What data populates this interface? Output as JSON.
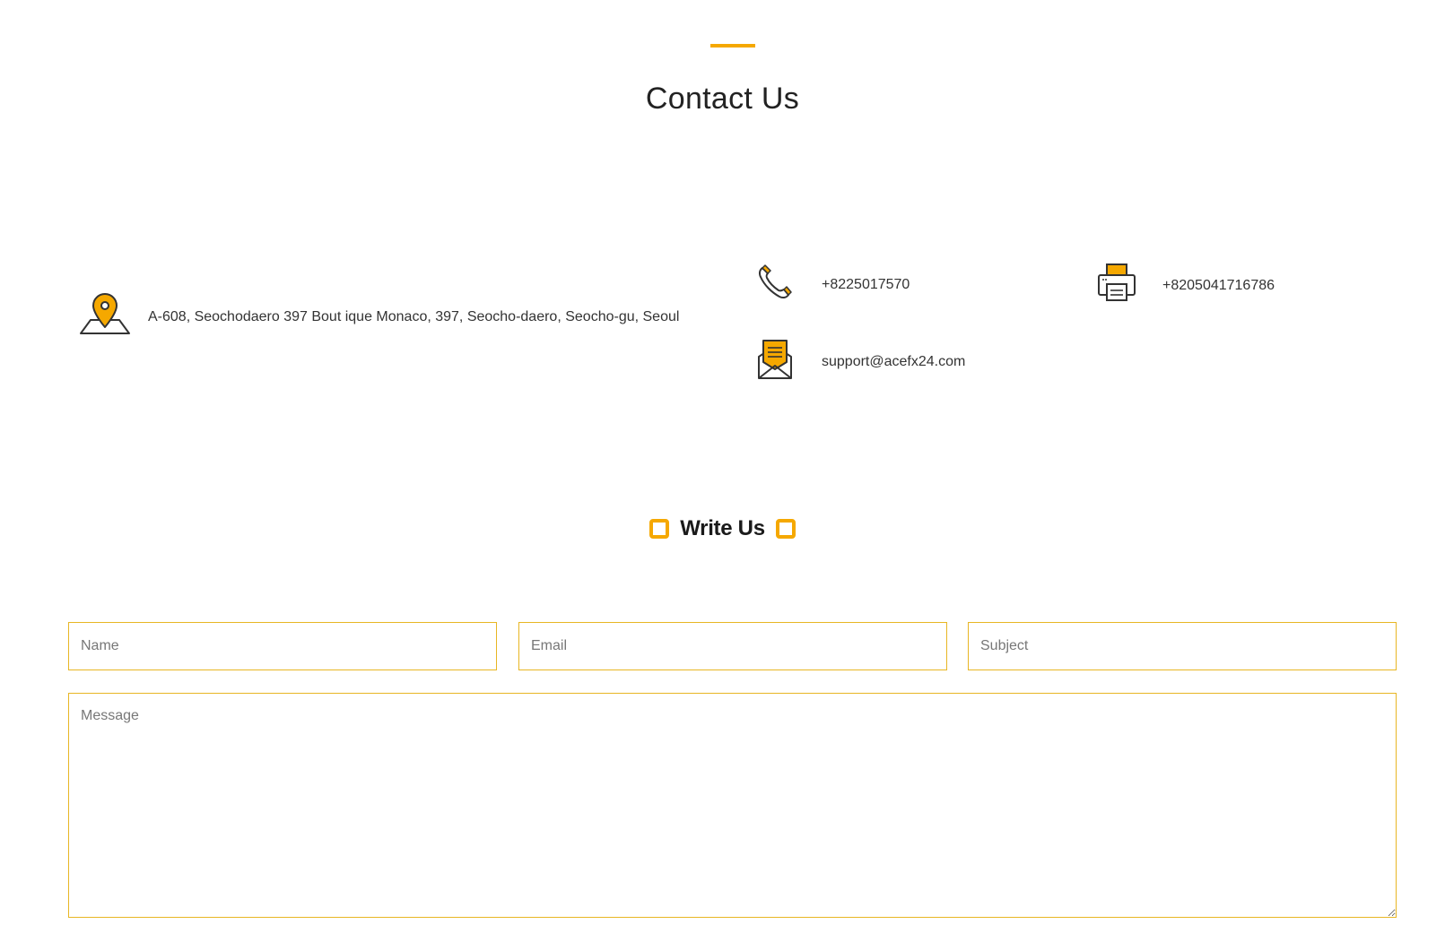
{
  "header": {
    "title": "Contact Us"
  },
  "contact": {
    "address": "A-608, Seochodaero 397 Bout ique Monaco, 397, Seocho-daero, Seocho-gu, Seoul",
    "phone": "+8225017570",
    "fax": "+8205041716786",
    "email": "support@acefx24.com",
    "icons": {
      "address": "map-pin-icon",
      "phone": "phone-icon",
      "fax": "fax-printer-icon",
      "email": "envelope-icon"
    }
  },
  "form": {
    "heading": "Write Us",
    "name_placeholder": "Name",
    "email_placeholder": "Email",
    "subject_placeholder": "Subject",
    "message_placeholder": "Message"
  },
  "colors": {
    "accent": "#f5a800",
    "field_border": "#e8b624",
    "text": "#222222"
  }
}
